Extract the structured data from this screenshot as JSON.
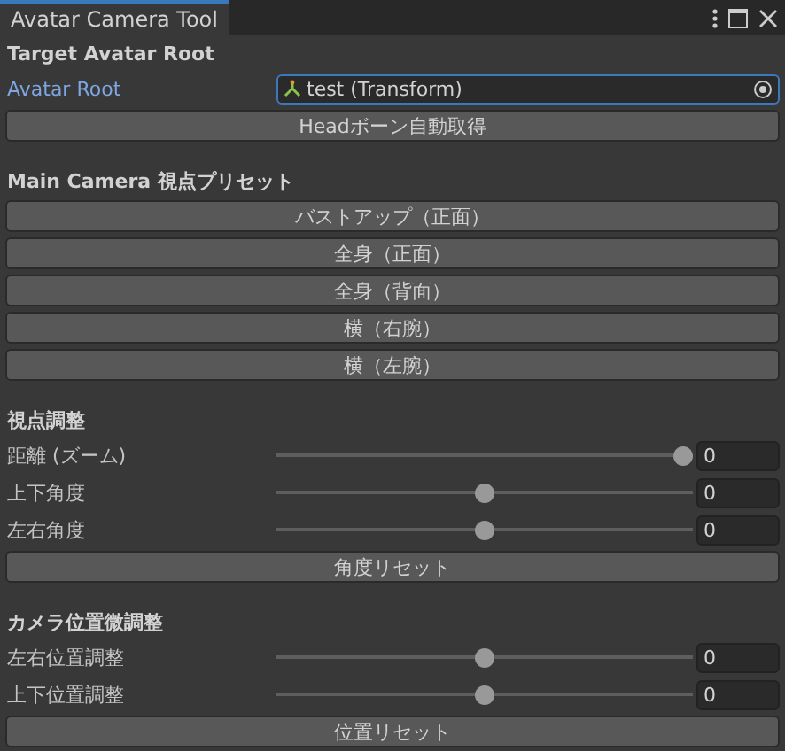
{
  "window": {
    "title": "Avatar Camera Tool"
  },
  "target": {
    "heading": "Target Avatar Root",
    "field_label": "Avatar Root",
    "field_value": "test (Transform)",
    "button": "Headボーン自動取得"
  },
  "presets": {
    "heading": "Main Camera 視点プリセット",
    "buttons": [
      "バストアップ（正面）",
      "全身（正面）",
      "全身（背面）",
      "横（右腕）",
      "横（左腕）"
    ]
  },
  "sections": [
    {
      "heading": "視点調整",
      "sliders": [
        {
          "label": "距離 (ズーム)",
          "level": 1.0,
          "value": "0"
        },
        {
          "label": "上下角度",
          "level": 0.5,
          "value": "0"
        },
        {
          "label": "左右角度",
          "level": 0.5,
          "value": "0"
        }
      ],
      "button": "角度リセット"
    },
    {
      "heading": "カメラ位置微調整",
      "sliders": [
        {
          "label": "左右位置調整",
          "level": 0.5,
          "value": "0"
        },
        {
          "label": "上下位置調整",
          "level": 0.5,
          "value": "0"
        }
      ],
      "button": "位置リセット"
    }
  ]
}
